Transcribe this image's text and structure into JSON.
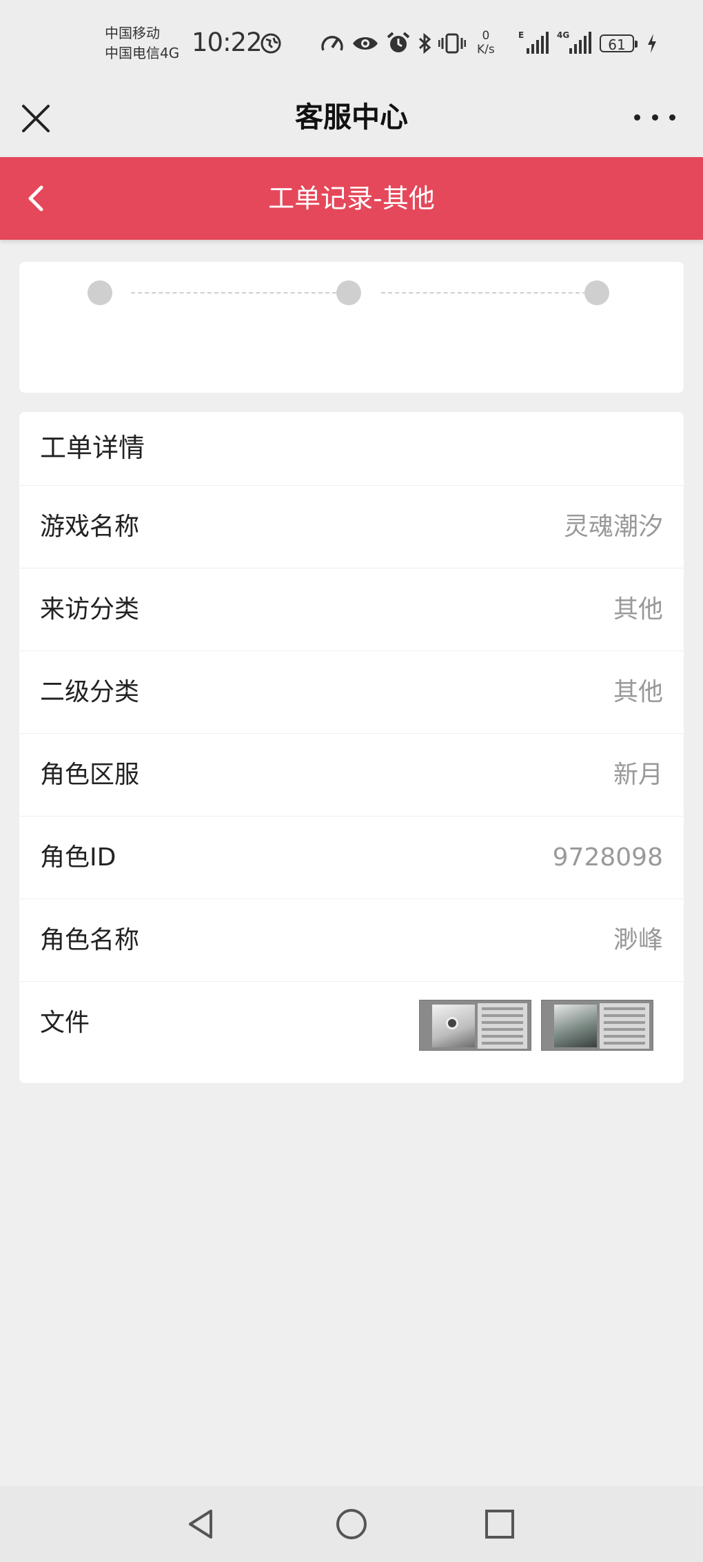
{
  "status_bar": {
    "carrier_1": "中国移动",
    "carrier_2": "中国电信4G",
    "time": "10:22",
    "speed_value": "0",
    "speed_unit": "K/s",
    "signal_1_tag": "E",
    "signal_2_tag": "4G",
    "battery": "61"
  },
  "app_header": {
    "title": "客服中心",
    "close_icon": "close-icon",
    "more_icon": "more-icon"
  },
  "nav": {
    "title": "工单记录-其他",
    "back_icon": "chevron-left-icon",
    "accent_color": "#e5485a"
  },
  "progress": {
    "step_count": 3
  },
  "details": {
    "title": "工单详情",
    "rows": [
      {
        "label": "游戏名称",
        "value": "灵魂潮汐"
      },
      {
        "label": "来访分类",
        "value": "其他"
      },
      {
        "label": "二级分类",
        "value": "其他"
      },
      {
        "label": "角色区服",
        "value": "新月"
      },
      {
        "label": "角色ID",
        "value": "9728098"
      },
      {
        "label": "角色名称",
        "value": "渺峰"
      }
    ],
    "file_label": "文件",
    "file_count": 2
  },
  "system_nav": {
    "back_icon": "triangle-back-icon",
    "home_icon": "circle-home-icon",
    "recent_icon": "square-recents-icon"
  }
}
